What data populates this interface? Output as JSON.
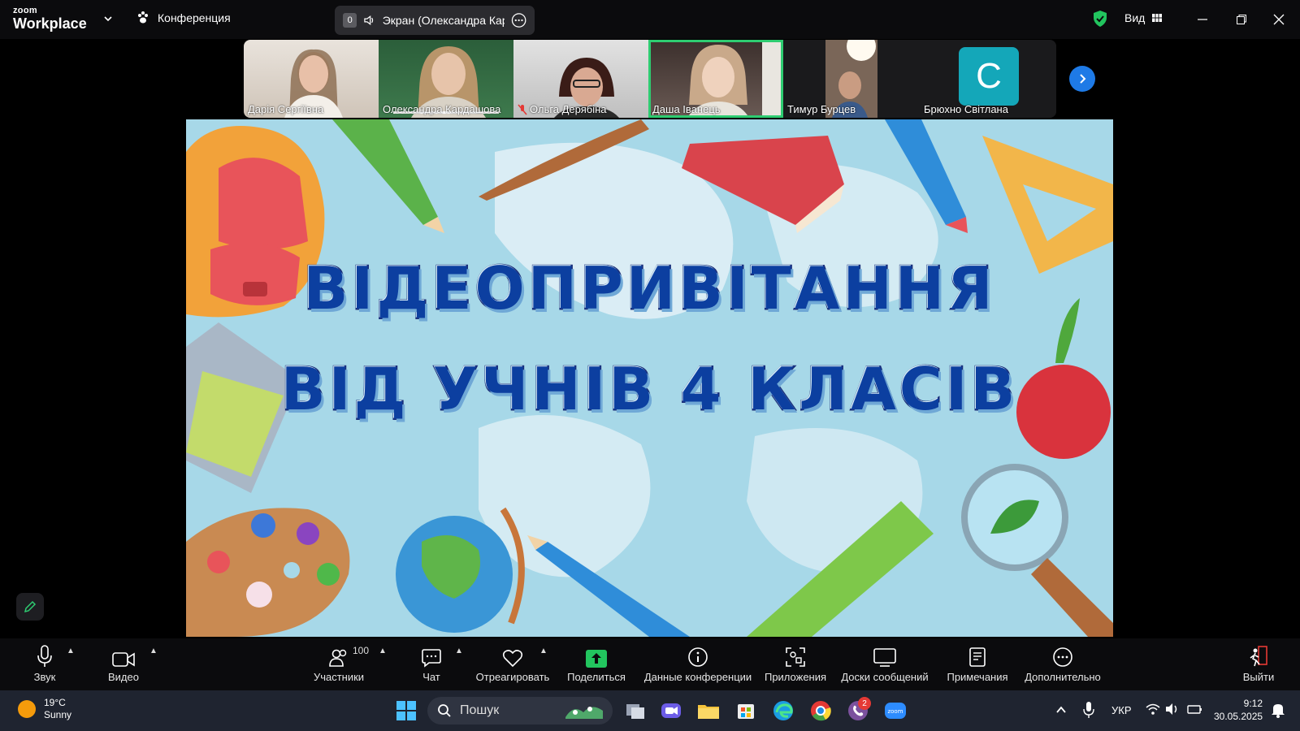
{
  "app": {
    "logo_small": "zoom",
    "logo_big": "Workplace",
    "conference_menu": "Конференция",
    "share_number": "0",
    "share_label": "Экран (Олександра Кардашова)",
    "view_label": "Вид"
  },
  "participants": [
    {
      "name": "Дарія Сергіївна",
      "muted": false,
      "active": false
    },
    {
      "name": "Олександра Кардашова",
      "muted": false,
      "active": false
    },
    {
      "name": "Ольга Дерябіна",
      "muted": true,
      "active": false
    },
    {
      "name": "Даша Іванець",
      "muted": false,
      "active": true
    },
    {
      "name": "Тимур Бурцев",
      "muted": false,
      "active": false
    },
    {
      "name": "Брюхно Світлана",
      "muted": false,
      "active": false,
      "avatar_letter": "C"
    }
  ],
  "slide": {
    "line1": "ВІДЕОПРИВІТАННЯ",
    "line2": "ВІД УЧНІВ 4 КЛАСІВ"
  },
  "toolbar": {
    "audio": "Звук",
    "video": "Видео",
    "participants": "Участники",
    "participants_count": "100",
    "chat": "Чат",
    "react": "Отреагировать",
    "share": "Поделиться",
    "info": "Данные конференции",
    "apps": "Приложения",
    "whiteboards": "Доски сообщений",
    "notes": "Примечания",
    "more": "Дополнительно",
    "leave": "Выйти"
  },
  "taskbar": {
    "temp": "19°C",
    "weather": "Sunny",
    "search": "Пошук",
    "lang": "УКР",
    "time": "9:12",
    "date": "30.05.2025",
    "viber_badge": "2"
  },
  "colors": {
    "accent_green": "#2ecc71",
    "brand_blue": "#1e7ae6",
    "share_green": "#22c55e",
    "leave_red": "#e53935",
    "title_blue": "#0c3fa0"
  }
}
